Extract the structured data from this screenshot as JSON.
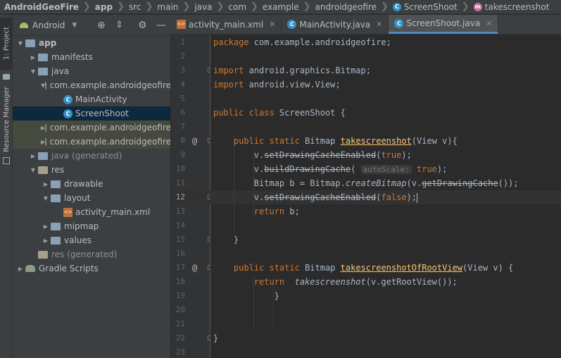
{
  "breadcrumb": [
    {
      "label": "AndroidGeoFire",
      "bold": true,
      "icon": ""
    },
    {
      "label": "app",
      "bold": true,
      "icon": ""
    },
    {
      "label": "src",
      "bold": false,
      "icon": ""
    },
    {
      "label": "main",
      "bold": false,
      "icon": ""
    },
    {
      "label": "java",
      "bold": false,
      "icon": ""
    },
    {
      "label": "com",
      "bold": false,
      "icon": ""
    },
    {
      "label": "example",
      "bold": false,
      "icon": ""
    },
    {
      "label": "androidgeofire",
      "bold": false,
      "icon": ""
    },
    {
      "label": "ScreenShoot",
      "bold": false,
      "icon": "class"
    },
    {
      "label": "takescreenshot",
      "bold": false,
      "icon": "method"
    }
  ],
  "toolstrip": {
    "project_tab": "1: Project",
    "resource_tab": "Resource Manager"
  },
  "project_panel": {
    "view_selector": "Android",
    "tree": [
      {
        "label": "app",
        "depth": 0,
        "arrow": "down",
        "icon": "module-folder",
        "style": ""
      },
      {
        "label": "manifests",
        "depth": 1,
        "arrow": "right",
        "icon": "folder",
        "style": ""
      },
      {
        "label": "java",
        "depth": 1,
        "arrow": "down",
        "icon": "folder",
        "style": ""
      },
      {
        "label": "com.example.androidgeofire",
        "depth": 2,
        "arrow": "down",
        "icon": "package",
        "style": ""
      },
      {
        "label": "MainActivity",
        "depth": 3,
        "arrow": "",
        "icon": "java-class",
        "style": ""
      },
      {
        "label": "ScreenShoot",
        "depth": 3,
        "arrow": "",
        "icon": "java-class",
        "style": "selected"
      },
      {
        "label": "com.example.androidgeofire",
        "depth": 2,
        "arrow": "right",
        "icon": "package",
        "style": "highlight"
      },
      {
        "label": "com.example.androidgeofire",
        "depth": 2,
        "arrow": "right",
        "icon": "package",
        "style": "highlight"
      },
      {
        "label": "java (generated)",
        "depth": 1,
        "arrow": "right",
        "icon": "folder",
        "style": "generated"
      },
      {
        "label": "res",
        "depth": 1,
        "arrow": "down",
        "icon": "res-folder",
        "style": ""
      },
      {
        "label": "drawable",
        "depth": 2,
        "arrow": "right",
        "icon": "folder",
        "style": ""
      },
      {
        "label": "layout",
        "depth": 2,
        "arrow": "down",
        "icon": "folder",
        "style": ""
      },
      {
        "label": "activity_main.xml",
        "depth": 3,
        "arrow": "",
        "icon": "xml-file",
        "style": ""
      },
      {
        "label": "mipmap",
        "depth": 2,
        "arrow": "right",
        "icon": "folder",
        "style": ""
      },
      {
        "label": "values",
        "depth": 2,
        "arrow": "right",
        "icon": "folder",
        "style": ""
      },
      {
        "label": "res (generated)",
        "depth": 1,
        "arrow": "",
        "icon": "res-folder",
        "style": "generated"
      },
      {
        "label": "Gradle Scripts",
        "depth": 0,
        "arrow": "right",
        "icon": "gradle",
        "style": ""
      }
    ]
  },
  "tabs": [
    {
      "label": "activity_main.xml",
      "icon": "xml-file",
      "active": false
    },
    {
      "label": "MainActivity.java",
      "icon": "java-class",
      "active": false
    },
    {
      "label": "ScreenShoot.java",
      "icon": "java-class",
      "active": true
    }
  ],
  "editor": {
    "current_line": 12,
    "annotated_lines": [
      8,
      17
    ],
    "lines": [
      [
        [
          "kw",
          "package "
        ],
        [
          "t",
          "com.example.androidgeofire;"
        ]
      ],
      [],
      [
        [
          "kw",
          "import "
        ],
        [
          "t",
          "android.graphics.Bitmap;"
        ]
      ],
      [
        [
          "kw",
          "import "
        ],
        [
          "t",
          "android.view.View;"
        ]
      ],
      [],
      [
        [
          "kw",
          "public class "
        ],
        [
          "t",
          "ScreenShoot {"
        ]
      ],
      [],
      [
        [
          "t",
          "    "
        ],
        [
          "kw",
          "public static "
        ],
        [
          "t",
          "Bitmap "
        ],
        [
          "fn",
          "takescreenshot"
        ],
        [
          "t",
          "(View v){"
        ]
      ],
      [
        [
          "t",
          "        v."
        ],
        [
          "strike",
          "setDrawingCacheEnabled"
        ],
        [
          "t",
          "("
        ],
        [
          "kw",
          "true"
        ],
        [
          "t",
          ");"
        ]
      ],
      [
        [
          "t",
          "        v."
        ],
        [
          "strike",
          "buildDrawingCache"
        ],
        [
          "t",
          "( "
        ],
        [
          "hint",
          "autoScale:"
        ],
        [
          "t",
          " "
        ],
        [
          "kw",
          "true"
        ],
        [
          "t",
          ");"
        ]
      ],
      [
        [
          "t",
          "        Bitmap b = Bitmap."
        ],
        [
          "st",
          "createBitmap"
        ],
        [
          "t",
          "(v."
        ],
        [
          "strike",
          "getDrawingCache"
        ],
        [
          "t",
          "());"
        ]
      ],
      [
        [
          "t",
          "        v."
        ],
        [
          "strike",
          "setDrawingCacheEnabled"
        ],
        [
          "t",
          "("
        ],
        [
          "kw",
          "false"
        ],
        [
          "t",
          ");"
        ],
        [
          "caret",
          ""
        ]
      ],
      [
        [
          "t",
          "        "
        ],
        [
          "kw",
          "return "
        ],
        [
          "t",
          "b;"
        ]
      ],
      [],
      [
        [
          "t",
          "    }"
        ]
      ],
      [],
      [
        [
          "t",
          "    "
        ],
        [
          "kw",
          "public static "
        ],
        [
          "t",
          "Bitmap "
        ],
        [
          "fn",
          "takescreenshotOfRootView"
        ],
        [
          "t",
          "(View v) {"
        ]
      ],
      [
        [
          "t",
          "        "
        ],
        [
          "kw",
          "return  "
        ],
        [
          "st",
          "takescreenshot"
        ],
        [
          "t",
          "(v.getRootView());"
        ]
      ],
      [
        [
          "t",
          "            }"
        ]
      ],
      [],
      [],
      [
        [
          "t",
          "}"
        ]
      ],
      []
    ]
  },
  "colors": {
    "panel": "#3c3f41",
    "editor_bg": "#2b2b2b",
    "keyword": "#cc7832",
    "method": "#ffc66d",
    "code": "#a9b7c6",
    "selection": "#0d293e",
    "accent": "#4a88c7"
  }
}
